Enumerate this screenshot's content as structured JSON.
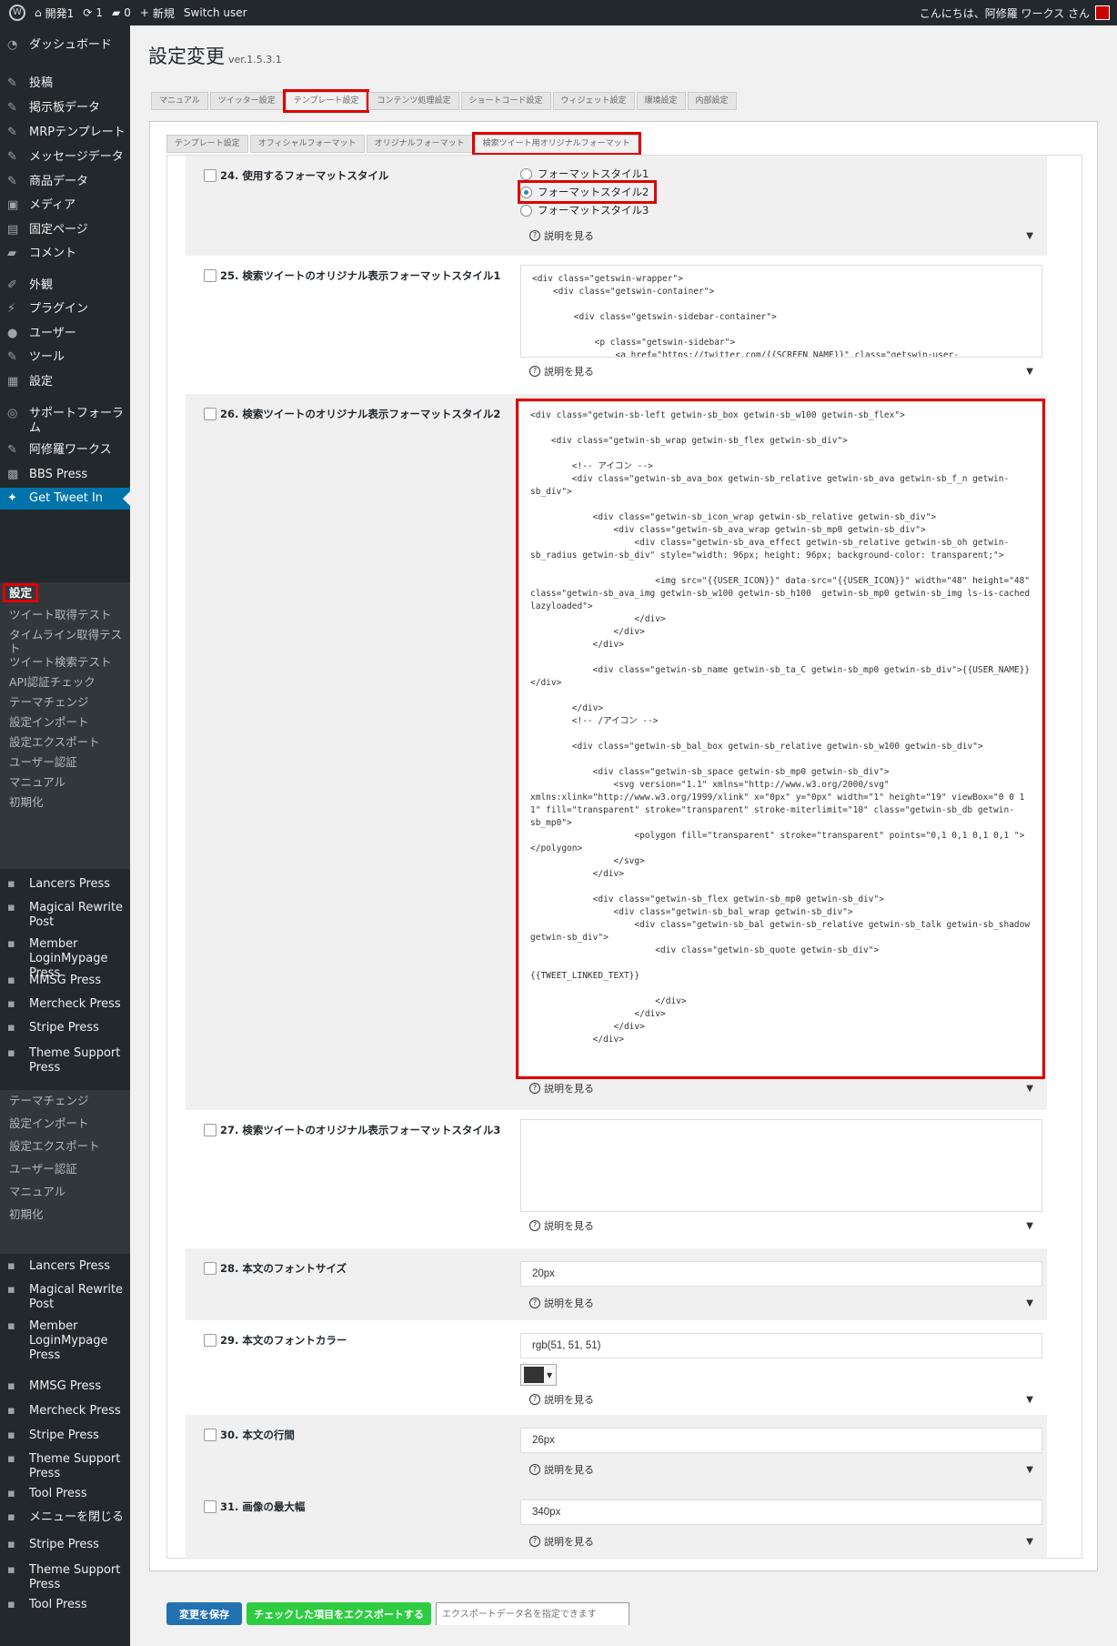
{
  "adminbar": {
    "site": "開発1",
    "updates": "1",
    "comments": "0",
    "new": "新規",
    "switch_user": "Switch user",
    "greeting": "こんにちは、阿修羅 ワークス さん"
  },
  "menu": [
    {
      "icon": "dashboard-icon",
      "label": "ダッシュボード"
    },
    {
      "icon": "pin-icon",
      "label": "投稿"
    },
    {
      "icon": "pin-icon",
      "label": "掲示板データ"
    },
    {
      "icon": "pin-icon",
      "label": "MRPテンプレート"
    },
    {
      "icon": "pin-icon",
      "label": "メッセージデータ"
    },
    {
      "icon": "pin-icon",
      "label": "商品データ"
    },
    {
      "icon": "media-icon",
      "label": "メディア"
    },
    {
      "icon": "page-icon",
      "label": "固定ページ"
    },
    {
      "icon": "comment-icon",
      "label": "コメント"
    },
    {
      "icon": "brush-icon",
      "label": "外観"
    },
    {
      "icon": "plugin-icon",
      "label": "プラグイン"
    },
    {
      "icon": "user-icon",
      "label": "ユーザー"
    },
    {
      "icon": "wrench-icon",
      "label": "ツール"
    },
    {
      "icon": "settings-icon",
      "label": "設定"
    },
    {
      "icon": "forum-icon",
      "label": "サポートフォーラム"
    },
    {
      "icon": "wrench-icon",
      "label": "阿修羅ワークス"
    },
    {
      "icon": "bbs-icon",
      "label": "BBS Press"
    },
    {
      "icon": "twitter-icon",
      "label": "Get Tweet In"
    }
  ],
  "submenu1": [
    "設定",
    "ツイート取得テスト",
    "タイムライン取得テスト",
    "ツイート検索テスト",
    "API認証チェック",
    "テーマチェンジ",
    "設定インポート",
    "設定エクスポート",
    "ユーザー認証",
    "マニュアル",
    "初期化"
  ],
  "menu2": [
    {
      "label": "Lancers Press"
    },
    {
      "label": "Magical Rewrite Post"
    },
    {
      "label": "Member LoginMypage Press"
    },
    {
      "label": "MMSG Press"
    },
    {
      "label": "Mercheck Press"
    },
    {
      "label": "Stripe Press"
    },
    {
      "label": "Theme Support Press"
    }
  ],
  "submenu2": [
    "テーマチェンジ",
    "設定インポート",
    "設定エクスポート",
    "ユーザー認証",
    "マニュアル",
    "初期化"
  ],
  "menu3": [
    {
      "label": "Lancers Press"
    },
    {
      "label": "Magical Rewrite Post"
    },
    {
      "label": "Member LoginMypage Press"
    },
    {
      "label": "MMSG Press"
    },
    {
      "label": "Mercheck Press"
    },
    {
      "label": "Stripe Press"
    },
    {
      "label": "Theme Support Press"
    },
    {
      "label": "Tool Press"
    },
    {
      "label": "メニューを閉じる"
    },
    {
      "label": "Stripe Press"
    },
    {
      "label": "Theme Support Press"
    },
    {
      "label": "Tool Press"
    }
  ],
  "page": {
    "title": "設定変更",
    "version": "ver.1.5.3.1"
  },
  "tabs": [
    "マニュアル",
    "ツイッター設定",
    "テンプレート設定",
    "コンテンツ処理設定",
    "ショートコード設定",
    "ウィジェット設定",
    "環境設定",
    "内部設定"
  ],
  "subtabs": [
    "テンプレート設定",
    "オフィシャルフォーマット",
    "オリジナルフォーマット",
    "検索ツイート用オリジナルフォーマット"
  ],
  "help_label": "説明を見る",
  "rows": {
    "r24": {
      "label": "24. 使用するフォーマットスタイル",
      "options": [
        "フォーマットスタイル1",
        "フォーマットスタイル2",
        "フォーマットスタイル3"
      ],
      "selected": "フォーマットスタイル2"
    },
    "r25": {
      "label": "25. 検索ツイートのオリジナル表示フォーマットスタイル1",
      "code": "<div class=\"getswin-wrapper\">\n    <div class=\"getswin-container\">\n\n        <div class=\"getswin-sidebar-container\">\n\n            <p class=\"getswin-sidebar\">\n                <a href=\"https://twitter.com/{{SCREEN_NAME}}\" class=\"getswin-user-"
    },
    "r26": {
      "label": "26. 検索ツイートのオリジナル表示フォーマットスタイル2",
      "code": "<div class=\"getwin-sb-left getwin-sb_box getwin-sb_w100 getwin-sb_flex\">\n\n    <div class=\"getwin-sb_wrap getwin-sb_flex getwin-sb_div\">\n\n        <!-- アイコン -->\n        <div class=\"getwin-sb_ava_box getwin-sb_relative getwin-sb_ava getwin-sb_f_n getwin-sb_div\">\n\n            <div class=\"getwin-sb_icon_wrap getwin-sb_relative getwin-sb_div\">\n                <div class=\"getwin-sb_ava_wrap getwin-sb_mp0 getwin-sb_div\">\n                    <div class=\"getwin-sb_ava_effect getwin-sb_relative getwin-sb_oh getwin-sb_radius getwin-sb_div\" style=\"width: 96px; height: 96px; background-color: transparent;\">\n\n                        <img src=\"{{USER_ICON}}\" data-src=\"{{USER_ICON}}\" width=\"48\" height=\"48\" class=\"getwin-sb_ava_img getwin-sb_w100 getwin-sb_h100  getwin-sb_mp0 getwin-sb_img ls-is-cached lazyloaded\">\n                    </div>\n                </div>\n            </div>\n\n            <div class=\"getwin-sb_name getwin-sb_ta_C getwin-sb_mp0 getwin-sb_div\">{{USER_NAME}}</div>\n\n        </div>\n        <!-- /アイコン -->\n\n        <div class=\"getwin-sb_bal_box getwin-sb_relative getwin-sb_w100 getwin-sb_div\">\n\n            <div class=\"getwin-sb_space getwin-sb_mp0 getwin-sb_div\">\n                <svg version=\"1.1\" xmlns=\"http://www.w3.org/2000/svg\" xmlns:xlink=\"http://www.w3.org/1999/xlink\" x=\"0px\" y=\"0px\" width=\"1\" height=\"19\" viewBox=\"0 0 1 1\" fill=\"transparent\" stroke=\"transparent\" stroke-miterlimit=\"10\" class=\"getwin-sb_db getwin-sb_mp0\">\n                    <polygon fill=\"transparent\" stroke=\"transparent\" points=\"0,1 0,1 0,1 0,1 \"></polygon>\n                </svg>\n            </div>\n\n            <div class=\"getwin-sb_flex getwin-sb_mp0 getwin-sb_div\">\n                <div class=\"getwin-sb_bal_wrap getwin-sb_div\">\n                    <div class=\"getwin-sb_bal getwin-sb_relative getwin-sb_talk getwin-sb_shadow getwin-sb_div\">\n                        <div class=\"getwin-sb_quote getwin-sb_div\">\n\n{{TWEET_LINKED_TEXT}}\n\n                        </div>\n                    </div>\n                </div>\n            </div>"
    },
    "r27": {
      "label": "27. 検索ツイートのオリジナル表示フォーマットスタイル3",
      "code": ""
    },
    "r28": {
      "label": "28. 本文のフォントサイズ",
      "value": "20px"
    },
    "r29": {
      "label": "29. 本文のフォントカラー",
      "value": "rgb(51, 51, 51)",
      "swatch": "#333333"
    },
    "r30": {
      "label": "30. 本文の行間",
      "value": "26px"
    },
    "r31": {
      "label": "31. 画像の最大幅",
      "value": "340px"
    }
  },
  "buttons": {
    "save": "変更を保存",
    "export": "チェックした項目をエクスポートする",
    "export_placeholder": "エクスポートデータ名を指定できます"
  },
  "colors": {
    "primary": "#2271b1",
    "green": "#2ecc40",
    "highlight": "#e00000",
    "menu_active": "#0073aa"
  }
}
